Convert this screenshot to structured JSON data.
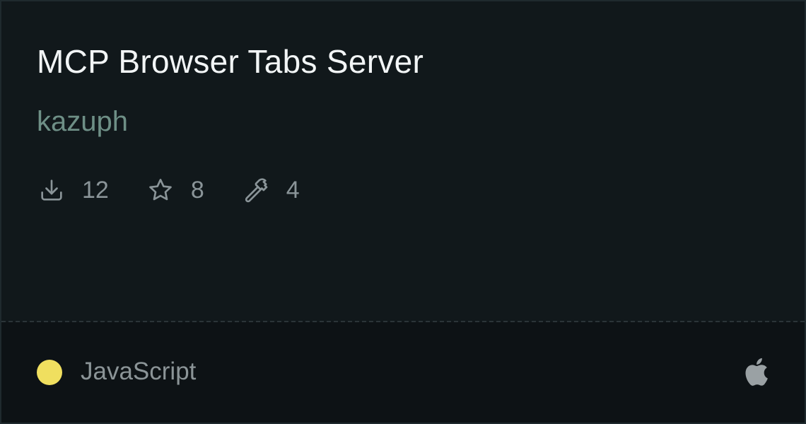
{
  "card": {
    "title": "MCP Browser Tabs Server",
    "author": "kazuph",
    "stats": {
      "downloads": "12",
      "stars": "8",
      "tools": "4"
    },
    "icons": {
      "downloads": "download-icon",
      "stars": "star-icon",
      "tools": "hammer-icon",
      "platform": "apple-icon"
    },
    "language": {
      "name": "JavaScript",
      "color": "#f0df5f"
    }
  },
  "colors": {
    "background": "#11181b",
    "footer_background": "#0d1215",
    "title": "#f2f5f6",
    "author": "#6e8f86",
    "muted": "#8a9498"
  }
}
